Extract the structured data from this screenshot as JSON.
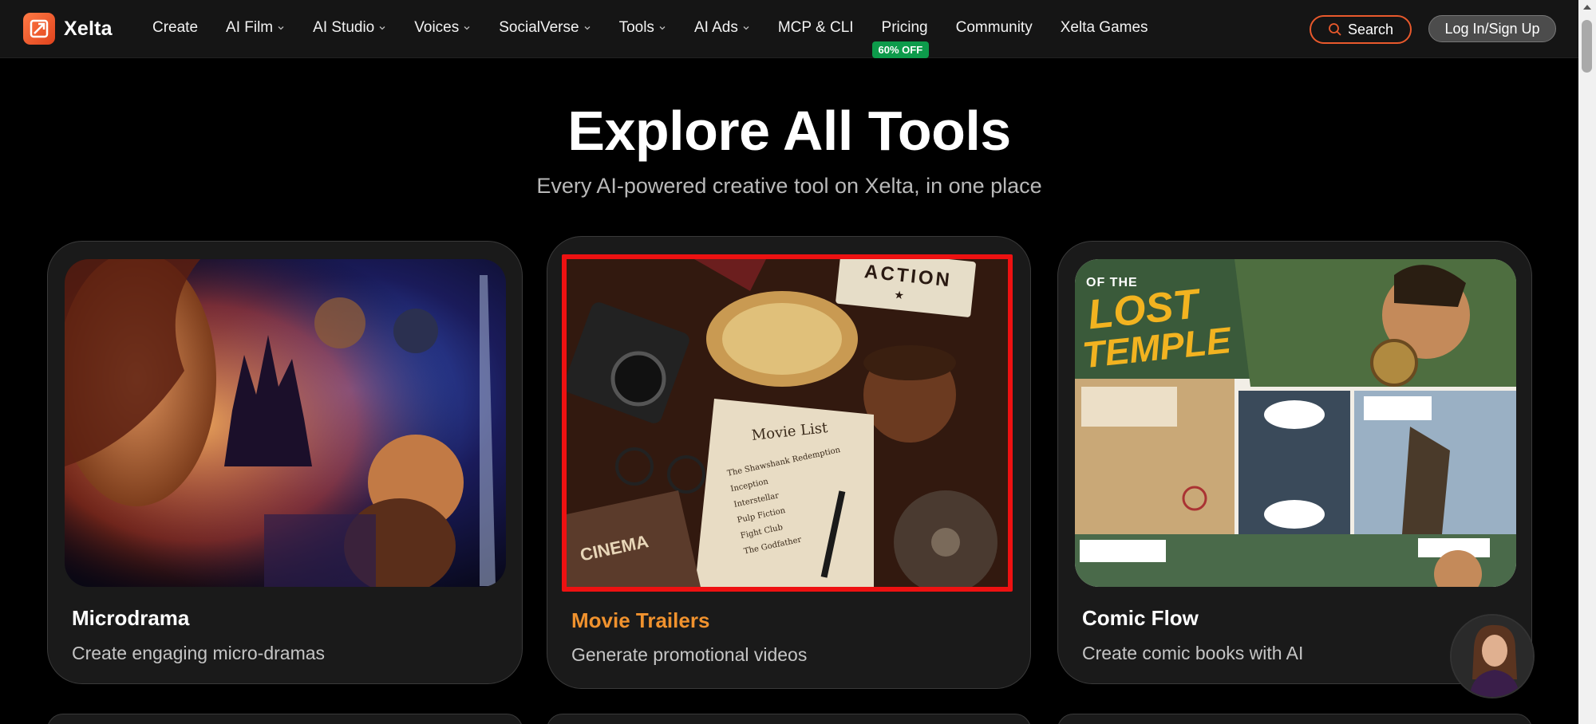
{
  "brand": {
    "name": "Xelta",
    "accent": "#e9592c"
  },
  "nav": {
    "items": [
      {
        "label": "Create",
        "dropdown": false
      },
      {
        "label": "AI Film",
        "dropdown": true
      },
      {
        "label": "AI Studio",
        "dropdown": true
      },
      {
        "label": "Voices",
        "dropdown": true
      },
      {
        "label": "SocialVerse",
        "dropdown": true
      },
      {
        "label": "Tools",
        "dropdown": true
      },
      {
        "label": "AI Ads",
        "dropdown": true
      },
      {
        "label": "MCP & CLI",
        "dropdown": false
      },
      {
        "label": "Pricing",
        "dropdown": false,
        "badge": "60% OFF"
      },
      {
        "label": "Community",
        "dropdown": false
      },
      {
        "label": "Xelta Games",
        "dropdown": false
      }
    ],
    "search_label": "Search",
    "login_label": "Log In/Sign Up"
  },
  "hero": {
    "title": "Explore All Tools",
    "subtitle": "Every AI-powered creative tool on Xelta, in one place"
  },
  "cards": [
    {
      "title": "Microdrama",
      "description": "Create engaging micro-dramas",
      "image_icon": "fantasy-poster-image"
    },
    {
      "title": "Movie Trailers",
      "description": "Generate promotional videos",
      "image_icon": "cinema-desk-image",
      "image_text": {
        "board": "ACTION",
        "notebook_title": "Movie List",
        "list": [
          "The Shawshank Redemption",
          "Inception",
          "Interstellar",
          "Pulp Fiction",
          "Fight Club",
          "The Godfather"
        ],
        "book": "CINEMA"
      }
    },
    {
      "title": "Comic Flow",
      "description": "Create comic books with AI",
      "image_icon": "comic-page-image",
      "image_text": {
        "title": "OF THE LOST TEMPLE"
      }
    }
  ]
}
